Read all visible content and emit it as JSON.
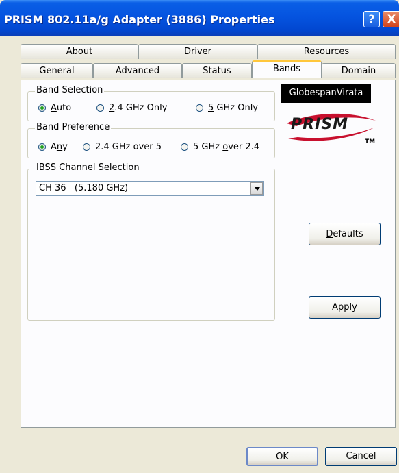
{
  "window": {
    "title": "PRISM 802.11a/g Adapter (3886) Properties",
    "help_glyph": "?",
    "close_glyph": "X"
  },
  "tabs": {
    "row1": [
      {
        "label": "About"
      },
      {
        "label": "Driver"
      },
      {
        "label": "Resources"
      }
    ],
    "row2": [
      {
        "label": "General"
      },
      {
        "label": "Advanced"
      },
      {
        "label": "Status"
      },
      {
        "label": "Bands",
        "active": true
      },
      {
        "label": "Domain"
      }
    ]
  },
  "band_selection": {
    "legend": "Band Selection",
    "options": [
      {
        "pre": "",
        "accel": "A",
        "post": "uto",
        "selected": true
      },
      {
        "pre": "",
        "accel": "2",
        "post": ".4 GHz Only",
        "selected": false
      },
      {
        "pre": "",
        "accel": "5",
        "post": " GHz Only",
        "selected": false
      }
    ]
  },
  "band_preference": {
    "legend": "Band Preference",
    "options": [
      {
        "pre": "A",
        "accel": "n",
        "post": "y",
        "selected": true
      },
      {
        "pre": "2.4 GHz over 5",
        "accel": "",
        "post": "",
        "selected": false
      },
      {
        "pre": "5 GHz ",
        "accel": "o",
        "post": "ver 2.4",
        "selected": false
      }
    ]
  },
  "ibss": {
    "legend": "IBSS Channel Selection",
    "value": "CH 36   (5.180 GHz)"
  },
  "logos": {
    "globespan": "GlobespanVirata",
    "prism": "PRISM",
    "tm": "TM"
  },
  "buttons": {
    "defaults": {
      "accel": "D",
      "rest": "efaults"
    },
    "apply": {
      "accel": "A",
      "rest": "pply"
    },
    "ok": "OK",
    "cancel": "Cancel"
  },
  "colors": {
    "titlebar": "#0554e0",
    "dialog_bg": "#ece9d8",
    "panel_bg": "#fcfcfe",
    "active_tab_accent": "#ffc73c",
    "radio_dot": "#21a121",
    "prism_swoosh": "#c8102e"
  }
}
